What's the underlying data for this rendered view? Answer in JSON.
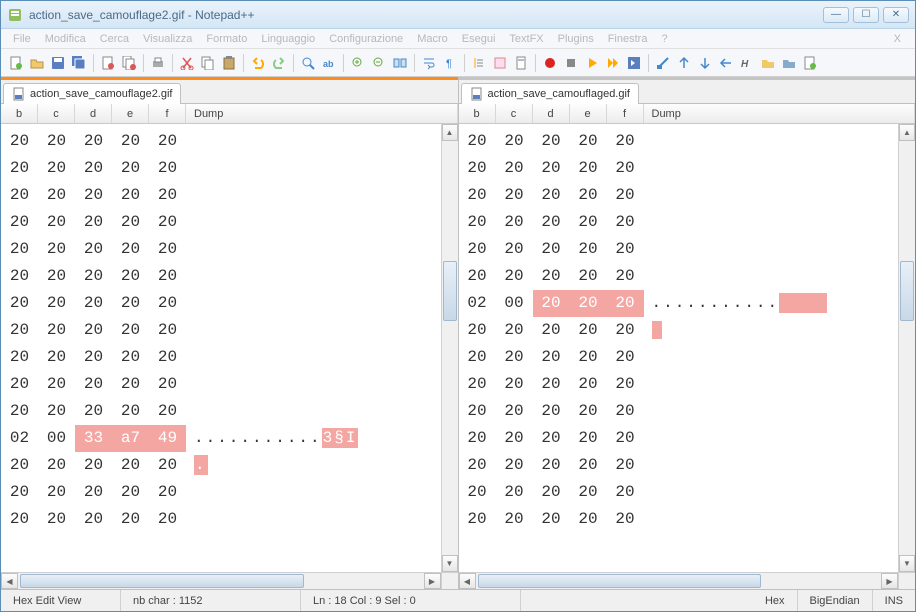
{
  "window": {
    "title": "action_save_camouflage2.gif - Notepad++"
  },
  "menu": [
    "File",
    "Modifica",
    "Cerca",
    "Visualizza",
    "Formato",
    "Linguaggio",
    "Configurazione",
    "Macro",
    "Esegui",
    "TextFX",
    "Plugins",
    "Finestra",
    "?"
  ],
  "panes": [
    {
      "active": true,
      "tab": "action_save_camouflage2.gif",
      "columns": [
        "b",
        "c",
        "d",
        "e",
        "f",
        "Dump"
      ],
      "rows": [
        {
          "hex": [
            "20",
            "20",
            "20",
            "20",
            "20"
          ],
          "dump": "",
          "hl": [],
          "dumpHl": ""
        },
        {
          "hex": [
            "20",
            "20",
            "20",
            "20",
            "20"
          ],
          "dump": "",
          "hl": [],
          "dumpHl": ""
        },
        {
          "hex": [
            "20",
            "20",
            "20",
            "20",
            "20"
          ],
          "dump": "",
          "hl": [],
          "dumpHl": ""
        },
        {
          "hex": [
            "20",
            "20",
            "20",
            "20",
            "20"
          ],
          "dump": "",
          "hl": [],
          "dumpHl": ""
        },
        {
          "hex": [
            "20",
            "20",
            "20",
            "20",
            "20"
          ],
          "dump": "",
          "hl": [],
          "dumpHl": ""
        },
        {
          "hex": [
            "20",
            "20",
            "20",
            "20",
            "20"
          ],
          "dump": "",
          "hl": [],
          "dumpHl": ""
        },
        {
          "hex": [
            "20",
            "20",
            "20",
            "20",
            "20"
          ],
          "dump": "",
          "hl": [],
          "dumpHl": ""
        },
        {
          "hex": [
            "20",
            "20",
            "20",
            "20",
            "20"
          ],
          "dump": "",
          "hl": [],
          "dumpHl": ""
        },
        {
          "hex": [
            "20",
            "20",
            "20",
            "20",
            "20"
          ],
          "dump": "",
          "hl": [],
          "dumpHl": ""
        },
        {
          "hex": [
            "20",
            "20",
            "20",
            "20",
            "20"
          ],
          "dump": "",
          "hl": [],
          "dumpHl": ""
        },
        {
          "hex": [
            "20",
            "20",
            "20",
            "20",
            "20"
          ],
          "dump": "",
          "hl": [],
          "dumpHl": ""
        },
        {
          "hex": [
            "02",
            "00",
            "33",
            "a7",
            "49"
          ],
          "dump": "...........",
          "hl": [
            2,
            3,
            4
          ],
          "dumpHl": "3§I"
        },
        {
          "hex": [
            "20",
            "20",
            "20",
            "20",
            "20"
          ],
          "dump": "",
          "hl": [],
          "dumpHl": ".",
          "dumpHlOnly": true
        },
        {
          "hex": [
            "20",
            "20",
            "20",
            "20",
            "20"
          ],
          "dump": "",
          "hl": [],
          "dumpHl": ""
        },
        {
          "hex": [
            "20",
            "20",
            "20",
            "20",
            "20"
          ],
          "dump": "",
          "hl": [],
          "dumpHl": ""
        }
      ]
    },
    {
      "active": false,
      "tab": "action_save_camouflaged.gif",
      "columns": [
        "b",
        "c",
        "d",
        "e",
        "f",
        "Dump"
      ],
      "rows": [
        {
          "hex": [
            "20",
            "20",
            "20",
            "20",
            "20"
          ],
          "dump": "",
          "hl": [],
          "dumpHl": ""
        },
        {
          "hex": [
            "20",
            "20",
            "20",
            "20",
            "20"
          ],
          "dump": "",
          "hl": [],
          "dumpHl": ""
        },
        {
          "hex": [
            "20",
            "20",
            "20",
            "20",
            "20"
          ],
          "dump": "",
          "hl": [],
          "dumpHl": ""
        },
        {
          "hex": [
            "20",
            "20",
            "20",
            "20",
            "20"
          ],
          "dump": "",
          "hl": [],
          "dumpHl": ""
        },
        {
          "hex": [
            "20",
            "20",
            "20",
            "20",
            "20"
          ],
          "dump": "",
          "hl": [],
          "dumpHl": ""
        },
        {
          "hex": [
            "20",
            "20",
            "20",
            "20",
            "20"
          ],
          "dump": "",
          "hl": [],
          "dumpHl": ""
        },
        {
          "hex": [
            "02",
            "00",
            "20",
            "20",
            "20"
          ],
          "dump": "...........",
          "hl": [
            2,
            3,
            4
          ],
          "dumpHl": "   ",
          "dumpHlBlock": true
        },
        {
          "hex": [
            "20",
            "20",
            "20",
            "20",
            "20"
          ],
          "dump": "",
          "hl": [],
          "dumpHl": "",
          "trailHl": true
        },
        {
          "hex": [
            "20",
            "20",
            "20",
            "20",
            "20"
          ],
          "dump": "",
          "hl": [],
          "dumpHl": ""
        },
        {
          "hex": [
            "20",
            "20",
            "20",
            "20",
            "20"
          ],
          "dump": "",
          "hl": [],
          "dumpHl": ""
        },
        {
          "hex": [
            "20",
            "20",
            "20",
            "20",
            "20"
          ],
          "dump": "",
          "hl": [],
          "dumpHl": ""
        },
        {
          "hex": [
            "20",
            "20",
            "20",
            "20",
            "20"
          ],
          "dump": "",
          "hl": [],
          "dumpHl": ""
        },
        {
          "hex": [
            "20",
            "20",
            "20",
            "20",
            "20"
          ],
          "dump": "",
          "hl": [],
          "dumpHl": ""
        },
        {
          "hex": [
            "20",
            "20",
            "20",
            "20",
            "20"
          ],
          "dump": "",
          "hl": [],
          "dumpHl": ""
        },
        {
          "hex": [
            "20",
            "20",
            "20",
            "20",
            "20"
          ],
          "dump": "",
          "hl": [],
          "dumpHl": ""
        }
      ]
    }
  ],
  "status": {
    "view": "Hex Edit View",
    "chars": "nb char : 1152",
    "pos": "Ln : 18    Col : 9    Sel : 0",
    "mode1": "Hex",
    "mode2": "BigEndian",
    "mode3": "INS"
  }
}
